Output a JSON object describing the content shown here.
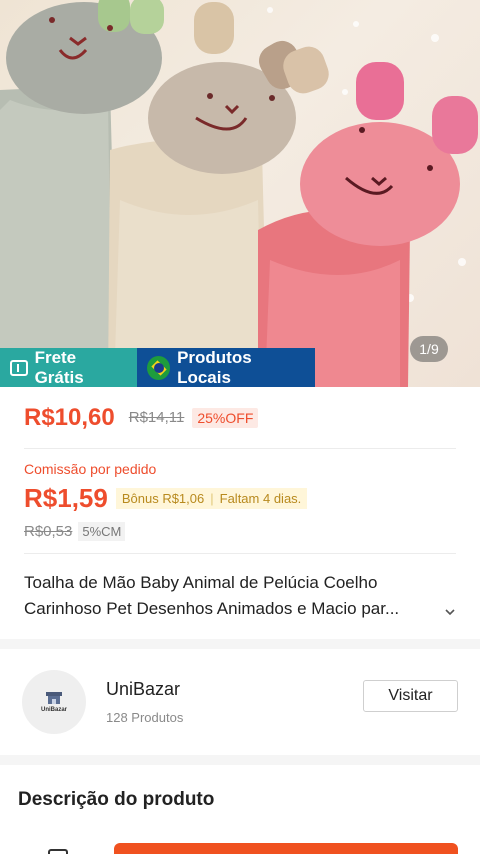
{
  "hero": {
    "image_counter": "1/9",
    "tags": {
      "frete": "Frete Grátis",
      "locais": "Produtos Locais"
    }
  },
  "price": {
    "current": "R$10,60",
    "original": "R$14,11",
    "discount": "25%OFF"
  },
  "commission": {
    "label": "Comissão por pedido",
    "value": "R$1,59",
    "bonus": "Bônus R$1,06",
    "deadline": "Faltam 4 dias.",
    "old_value": "R$0,53",
    "rate": "5%CM"
  },
  "product": {
    "title_line1": "Toalha de Mão Baby Animal de Pelúcia Coelho",
    "title_line2": "Carinhoso Pet Desenhos Animados e Macio par..."
  },
  "shop": {
    "logo_text": "UniBazar",
    "name": "UniBazar",
    "count": "128 Produtos",
    "visit_label": "Visitar"
  },
  "description": {
    "title": "Descrição do produto"
  },
  "colors": {
    "accent": "#ee4d2d",
    "frete_tag": "#2aa8a0",
    "locais_tag": "#0e4f96",
    "buy_button": "#f0511f"
  }
}
